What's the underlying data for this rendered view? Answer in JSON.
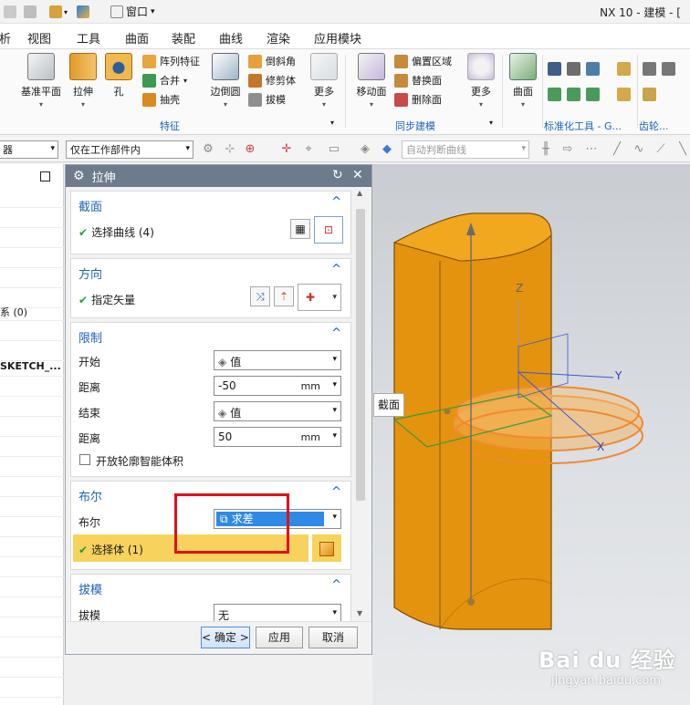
{
  "title_bar": {
    "window_menu_label": "窗口",
    "app_title": "NX 10 - 建模 - [",
    "window_menu_arrow": "▾"
  },
  "menu_bar": {
    "items": [
      "析",
      "视图",
      "工具",
      "曲面",
      "装配",
      "曲线",
      "渲染",
      "应用模块"
    ]
  },
  "ribbon": {
    "feature": {
      "datum_plane": "基准平面",
      "extrude": "拉伸",
      "hole": "孔",
      "pattern_feature": "阵列特征",
      "unite": "合并",
      "shell": "抽壳",
      "edge_blend": "边倒圆",
      "chamfer": "倒斜角",
      "trim_body": "修剪体",
      "draft": "拔模",
      "more": "更多",
      "group_label": "特征"
    },
    "sync": {
      "move_face": "移动面",
      "offset_region": "偏置区域",
      "replace_face": "替换面",
      "delete_face": "删除面",
      "more": "更多",
      "group_label": "同步建模"
    },
    "surface": {
      "label": "曲面"
    },
    "standard_tools": {
      "group_label": "标准化工具 - G..."
    },
    "gear": {
      "group_label": "齿轮..."
    }
  },
  "selection_bar": {
    "type_filter_partial": "器",
    "scope": "仅在工作部件内",
    "curve_rule": "自动判断曲线"
  },
  "navigator": {
    "rows": [
      "",
      "",
      "",
      "",
      "",
      "",
      "",
      "系 (0)",
      "",
      "",
      "SKETCH_..."
    ]
  },
  "dialog": {
    "title": "拉伸",
    "reset_icon": "↻",
    "close_icon": "✕",
    "section_curve": {
      "header": "截面",
      "select_curve": "选择曲线 (4)"
    },
    "direction": {
      "header": "方向",
      "specify_vector": "指定矢量"
    },
    "limits": {
      "header": "限制",
      "start_label": "开始",
      "start_value": "值",
      "start_distance_label": "距离",
      "start_distance": "-50",
      "end_label": "结束",
      "end_value": "值",
      "end_distance_label": "距离",
      "end_distance": "50",
      "unit": "mm",
      "open_profile": "开放轮廓智能体积"
    },
    "boolean": {
      "header": "布尔",
      "label": "布尔",
      "value": "求差",
      "select_body": "选择体 (1)"
    },
    "draft": {
      "header": "拔模",
      "label": "拔模",
      "value": "无"
    },
    "buttons": {
      "ok": "< 确定 >",
      "apply": "应用",
      "cancel": "取消"
    }
  },
  "graphics": {
    "section_tip": "截面",
    "axis_x": "X",
    "axis_y": "Y",
    "axis_z": "Z"
  },
  "watermark": {
    "main": "Bai du 经验",
    "sub": "jingyan.baidu.com"
  },
  "colors": {
    "title_blue": "#1c63b7",
    "dialog_header": "#6d7b8d",
    "body_orange": "#e8940f",
    "highlight_yellow": "#f7d35d",
    "boolean_blue": "#2f8ae6",
    "red_annotation": "#e0101a"
  }
}
